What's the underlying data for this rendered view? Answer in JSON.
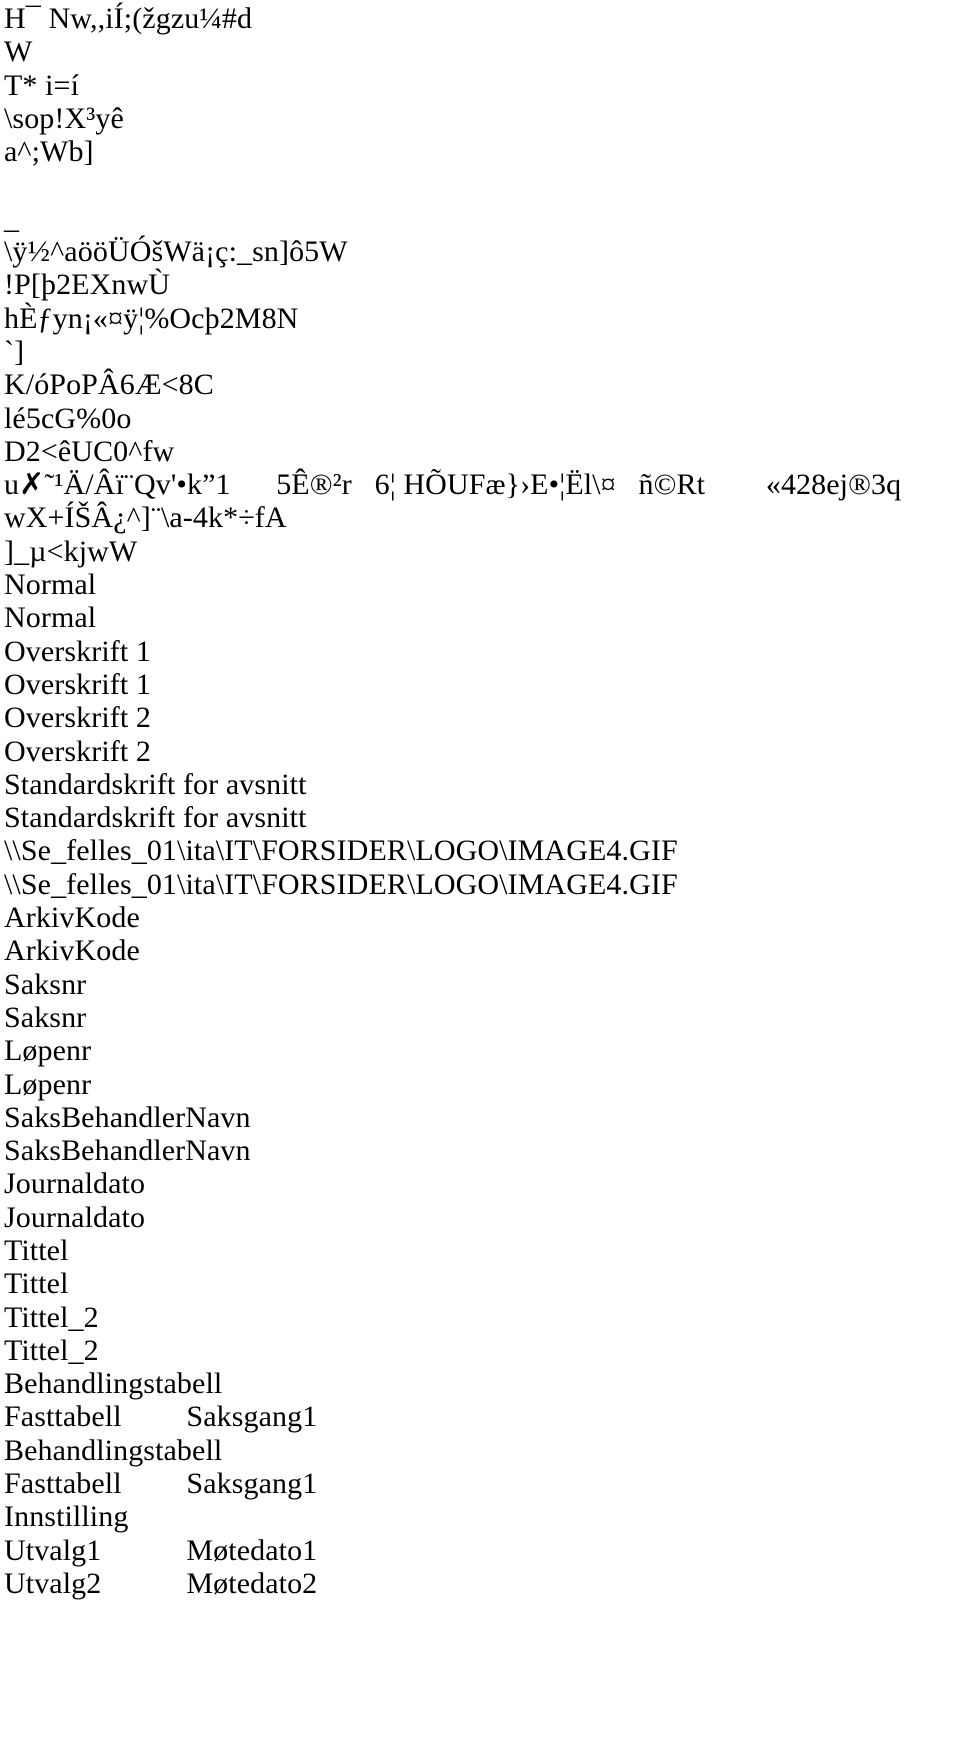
{
  "document": {
    "type": "extracted-text-page",
    "background_color": "#ffffff",
    "text_color": "#000000",
    "lines": [
      {
        "id": "line-1",
        "text": "H¯ Nw,,iÍ;(žgzu¼#d"
      },
      {
        "id": "line-2",
        "text": "W"
      },
      {
        "id": "line-3",
        "text": "T* i=í"
      },
      {
        "id": "line-4",
        "text": "\\sop!X³yê"
      },
      {
        "id": "line-5",
        "text": "a^;Wb]"
      },
      {
        "id": "line-6",
        "text": ""
      },
      {
        "id": "line-7",
        "text": "_"
      },
      {
        "id": "line-8",
        "text": "\\ÿ½^aööÜÓšWä¡ç:_sn]ô5W"
      },
      {
        "id": "line-9",
        "text": "!P[þ2EXnwÙ"
      },
      {
        "id": "line-10",
        "text": "hÈƒyn¡«¤ÿ¦%Ocþ2M8N"
      },
      {
        "id": "line-11",
        "text": "`]"
      },
      {
        "id": "line-12",
        "text": "K/óPoPÂ6Æ<8C"
      },
      {
        "id": "line-13",
        "text": "lé5cG%0o"
      },
      {
        "id": "line-14",
        "text": "D2<êUC0^fw"
      },
      {
        "id": "line-15",
        "text": "u✗˜¹Ä/Âï¨Qv'•k”1      5Ê®²r   6¦ HÕUFæ}›E•¦Ël\\¤   ñ©Rt        «428ej®3q"
      },
      {
        "id": "line-16",
        "text": "wX+ÍŠÂ¿^]¨\\a-4k*÷fA"
      },
      {
        "id": "line-17",
        "text": "]_µ<kjwW"
      },
      {
        "id": "line-18",
        "text": "Normal"
      },
      {
        "id": "line-19",
        "text": "Normal"
      },
      {
        "id": "line-20",
        "text": "Overskrift 1"
      },
      {
        "id": "line-21",
        "text": "Overskrift 1"
      },
      {
        "id": "line-22",
        "text": "Overskrift 2"
      },
      {
        "id": "line-23",
        "text": "Overskrift 2"
      },
      {
        "id": "line-24",
        "text": "Standardskrift for avsnitt"
      },
      {
        "id": "line-25",
        "text": "Standardskrift for avsnitt"
      },
      {
        "id": "line-26",
        "text": "\\\\Se_felles_01\\ita\\IT\\FORSIDER\\LOGO\\IMAGE4.GIF"
      },
      {
        "id": "line-27",
        "text": "\\\\Se_felles_01\\ita\\IT\\FORSIDER\\LOGO\\IMAGE4.GIF"
      },
      {
        "id": "line-28",
        "text": "ArkivKode"
      },
      {
        "id": "line-29",
        "text": "ArkivKode"
      },
      {
        "id": "line-30",
        "text": "Saksnr"
      },
      {
        "id": "line-31",
        "text": "Saksnr"
      },
      {
        "id": "line-32",
        "text": "Løpenr"
      },
      {
        "id": "line-33",
        "text": "Løpenr"
      },
      {
        "id": "line-34",
        "text": "SaksBehandlerNavn"
      },
      {
        "id": "line-35",
        "text": "SaksBehandlerNavn"
      },
      {
        "id": "line-36",
        "text": "Journaldato"
      },
      {
        "id": "line-37",
        "text": "Journaldato"
      },
      {
        "id": "line-38",
        "text": "Tittel"
      },
      {
        "id": "line-39",
        "text": "Tittel"
      },
      {
        "id": "line-40",
        "text": "Tittel_2"
      },
      {
        "id": "line-41",
        "text": "Tittel_2"
      },
      {
        "id": "line-42",
        "text": "Behandlingstabell"
      },
      {
        "id": "line-43",
        "text": "Fasttabell\t\tSaksgang1"
      },
      {
        "id": "line-44",
        "text": "Behandlingstabell"
      },
      {
        "id": "line-45",
        "text": "Fasttabell\t\tSaksgang1"
      },
      {
        "id": "line-46",
        "text": "Innstilling"
      },
      {
        "id": "line-47",
        "text": "Utvalg1\t\tMøtedato1"
      },
      {
        "id": "line-48",
        "text": "Utvalg2\t\tMøtedato2"
      }
    ]
  }
}
